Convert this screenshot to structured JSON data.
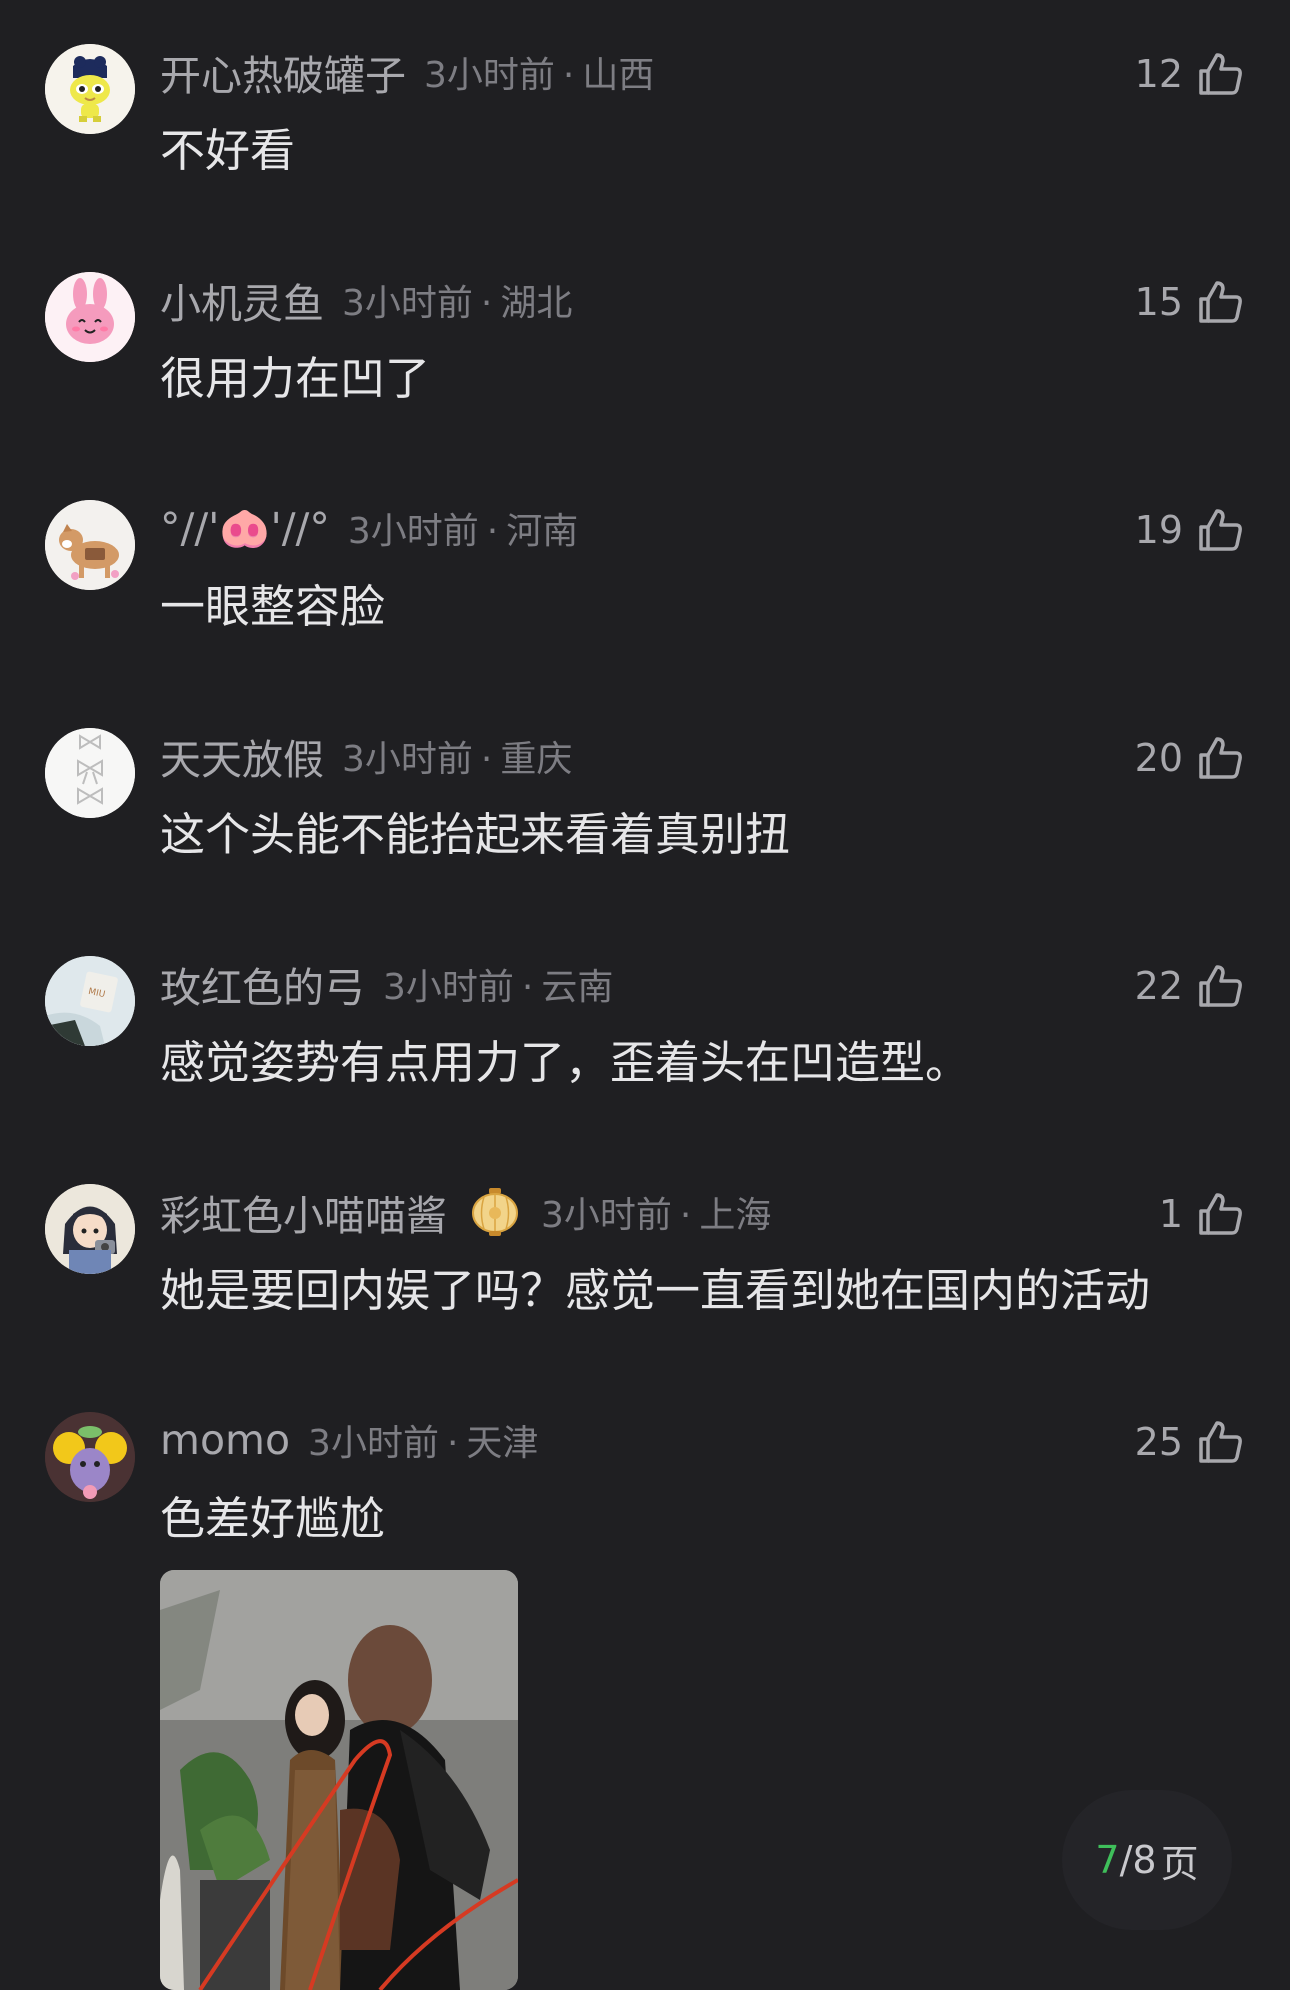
{
  "comments": [
    {
      "user": "开心热破罐子",
      "time": "3小时前",
      "region": "山西",
      "likes": "12",
      "text": "不好看",
      "avatar_icon": "tamagotchi-character-icon"
    },
    {
      "user": "小机灵鱼",
      "time": "3小时前",
      "region": "湖北",
      "likes": "15",
      "text": "很用力在凹了",
      "avatar_icon": "pink-bunny-icon"
    },
    {
      "user": "°//'🐽'//°",
      "time": "3小时前",
      "region": "河南",
      "likes": "19",
      "text": "一眼整容脸",
      "avatar_icon": "shiba-dog-icon"
    },
    {
      "user": "天天放假",
      "time": "3小时前",
      "region": "重庆",
      "likes": "20",
      "text": "这个头能不能抬起来看着真别扭",
      "avatar_icon": "bows-icon"
    },
    {
      "user": "玫红色的弓",
      "time": "3小时前",
      "region": "云南",
      "likes": "22",
      "text": "感觉姿势有点用力了，歪着头在凹造型。",
      "avatar_icon": "shopping-bag-icon"
    },
    {
      "user": "彩虹色小喵喵酱",
      "time": "3小时前",
      "region": "上海",
      "likes": "1",
      "text": "她是要回内娱了吗？感觉一直看到她在国内的活动",
      "avatar_icon": "anime-girl-icon",
      "badge_icon": "lantern-icon"
    },
    {
      "user": "momo",
      "time": "3小时前",
      "region": "天津",
      "likes": "25",
      "text": "色差好尴尬",
      "avatar_icon": "purple-creature-icon"
    }
  ],
  "pager": {
    "current": "7",
    "sep": "/",
    "total": "8",
    "unit": "页"
  },
  "colors": {
    "background": "#1f1f22",
    "accent": "#3fbf5b",
    "username": "#a8a8ad",
    "meta": "#7d7d83",
    "text": "#e6e6e8"
  }
}
